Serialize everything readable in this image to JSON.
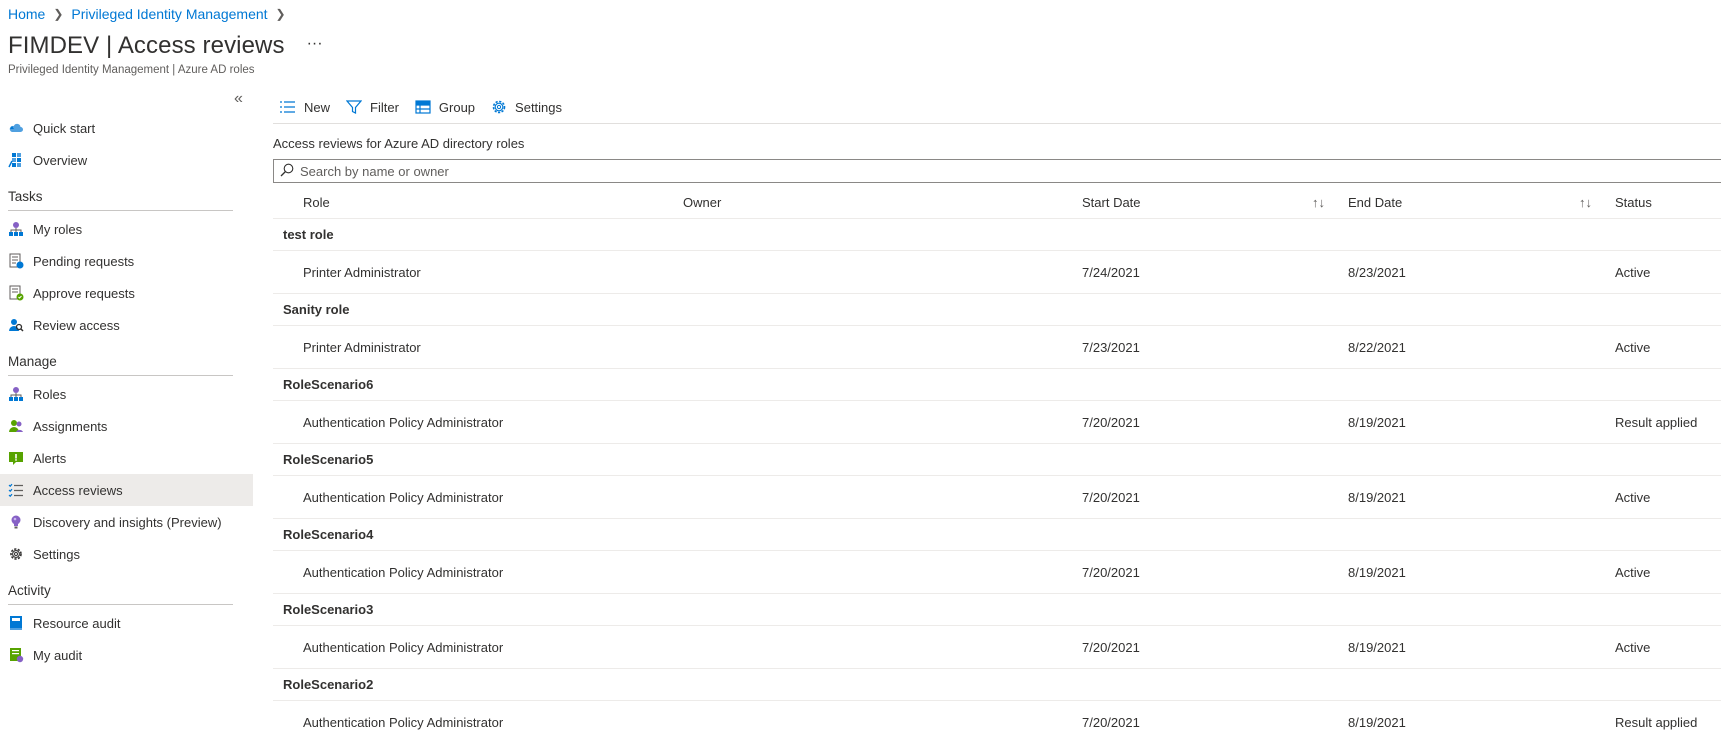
{
  "breadcrumb": {
    "items": [
      "Home",
      "Privileged Identity Management"
    ]
  },
  "header": {
    "title": "FIMDEV | Access reviews",
    "more": "···",
    "subtitle": "Privileged Identity Management | Azure AD roles"
  },
  "sidebar": {
    "collapse": "«",
    "top_items": [
      {
        "label": "Quick start",
        "icon": "cloud-icon"
      },
      {
        "label": "Overview",
        "icon": "grid-icon"
      }
    ],
    "sections": [
      {
        "title": "Tasks",
        "items": [
          {
            "label": "My roles",
            "icon": "hierarchy-icon"
          },
          {
            "label": "Pending requests",
            "icon": "pending-icon"
          },
          {
            "label": "Approve requests",
            "icon": "approve-icon"
          },
          {
            "label": "Review access",
            "icon": "review-icon"
          }
        ]
      },
      {
        "title": "Manage",
        "items": [
          {
            "label": "Roles",
            "icon": "hierarchy-icon"
          },
          {
            "label": "Assignments",
            "icon": "users-icon"
          },
          {
            "label": "Alerts",
            "icon": "alert-icon"
          },
          {
            "label": "Access reviews",
            "icon": "checklist-icon",
            "active": true
          },
          {
            "label": "Discovery and insights (Preview)",
            "icon": "lightbulb-icon"
          },
          {
            "label": "Settings",
            "icon": "gear-icon"
          }
        ]
      },
      {
        "title": "Activity",
        "items": [
          {
            "label": "Resource audit",
            "icon": "book-icon"
          },
          {
            "label": "My audit",
            "icon": "audit-icon"
          }
        ]
      }
    ]
  },
  "toolbar": {
    "new_label": "New",
    "filter_label": "Filter",
    "group_label": "Group",
    "settings_label": "Settings"
  },
  "main": {
    "section_title": "Access reviews for Azure AD directory roles",
    "search_placeholder": "Search by name or owner",
    "columns": {
      "role": "Role",
      "owner": "Owner",
      "start_date": "Start Date",
      "end_date": "End Date",
      "status": "Status",
      "sort_glyph": "↑↓"
    },
    "groups": [
      {
        "name": "test role",
        "rows": [
          {
            "role": "Printer Administrator",
            "owner": "",
            "start": "7/24/2021",
            "end": "8/23/2021",
            "status": "Active"
          }
        ]
      },
      {
        "name": "Sanity role",
        "rows": [
          {
            "role": "Printer Administrator",
            "owner": "",
            "start": "7/23/2021",
            "end": "8/22/2021",
            "status": "Active"
          }
        ]
      },
      {
        "name": "RoleScenario6",
        "rows": [
          {
            "role": "Authentication Policy Administrator",
            "owner": "",
            "start": "7/20/2021",
            "end": "8/19/2021",
            "status": "Result applied"
          }
        ]
      },
      {
        "name": "RoleScenario5",
        "rows": [
          {
            "role": "Authentication Policy Administrator",
            "owner": "",
            "start": "7/20/2021",
            "end": "8/19/2021",
            "status": "Active"
          }
        ]
      },
      {
        "name": "RoleScenario4",
        "rows": [
          {
            "role": "Authentication Policy Administrator",
            "owner": "",
            "start": "7/20/2021",
            "end": "8/19/2021",
            "status": "Active"
          }
        ]
      },
      {
        "name": "RoleScenario3",
        "rows": [
          {
            "role": "Authentication Policy Administrator",
            "owner": "",
            "start": "7/20/2021",
            "end": "8/19/2021",
            "status": "Active"
          }
        ]
      },
      {
        "name": "RoleScenario2",
        "rows": [
          {
            "role": "Authentication Policy Administrator",
            "owner": "",
            "start": "7/20/2021",
            "end": "8/19/2021",
            "status": "Result applied"
          }
        ]
      }
    ]
  },
  "colors": {
    "accent": "#0078d4",
    "active_nav_bg": "#edebe9",
    "text": "#323130",
    "secondary_text": "#605e5c"
  }
}
